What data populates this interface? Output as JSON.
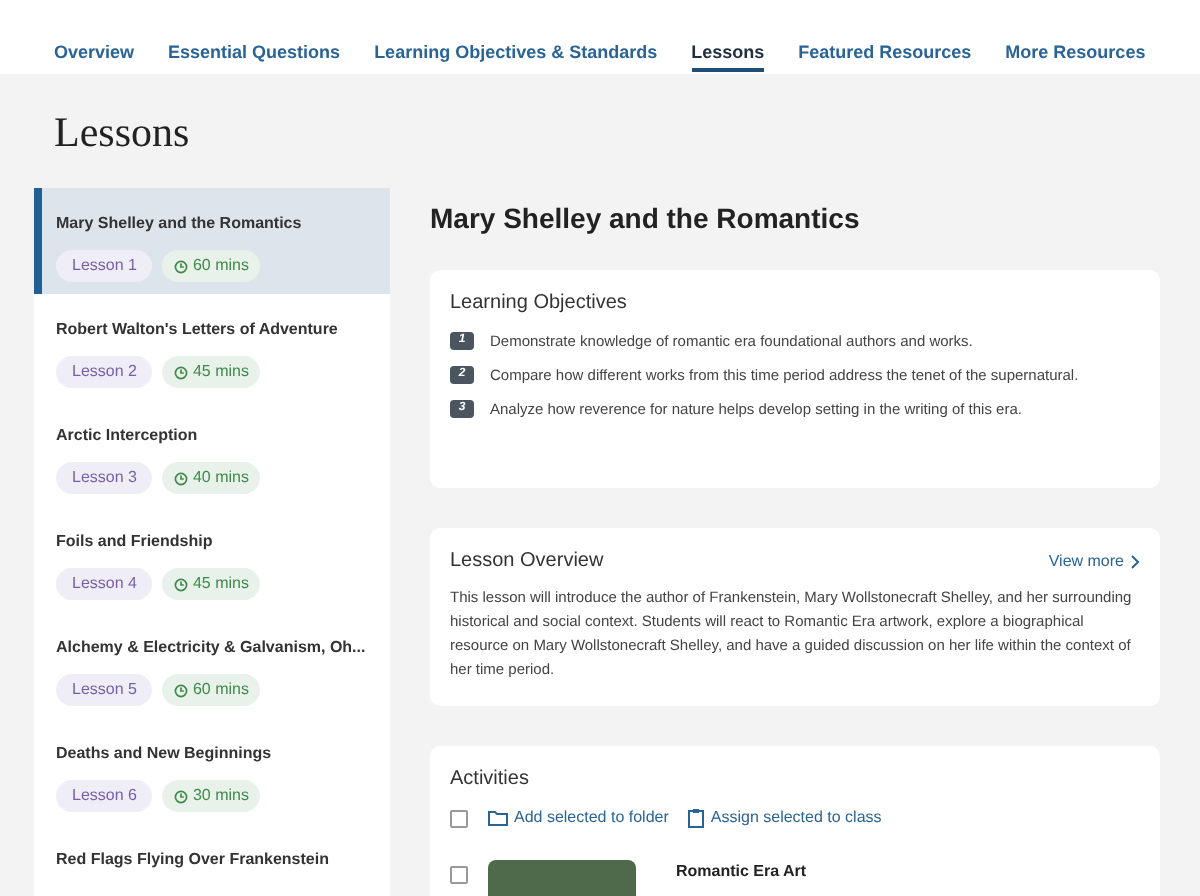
{
  "tabs": [
    {
      "label": "Overview",
      "selected": false
    },
    {
      "label": "Essential Questions",
      "selected": false
    },
    {
      "label": "Learning Objectives & Standards",
      "selected": false
    },
    {
      "label": "Lessons",
      "selected": true
    },
    {
      "label": "Featured Resources",
      "selected": false
    },
    {
      "label": "More Resources",
      "selected": false
    }
  ],
  "page_title": "Lessons",
  "lessons": [
    {
      "title": "Mary Shelley and the Romantics",
      "number": "Lesson 1",
      "duration": "60 mins",
      "selected": true
    },
    {
      "title": "Robert Walton's Letters of Adventure",
      "number": "Lesson 2",
      "duration": "45 mins",
      "selected": false
    },
    {
      "title": "Arctic Interception",
      "number": "Lesson 3",
      "duration": "40 mins",
      "selected": false
    },
    {
      "title": "Foils and Friendship",
      "number": "Lesson 4",
      "duration": "45 mins",
      "selected": false
    },
    {
      "title": "Alchemy & Electricity & Galvanism, Oh...",
      "number": "Lesson 5",
      "duration": "60 mins",
      "selected": false
    },
    {
      "title": "Deaths and New Beginnings",
      "number": "Lesson 6",
      "duration": "30 mins",
      "selected": false
    },
    {
      "title": "Red Flags Flying Over Frankenstein",
      "selected": false
    }
  ],
  "lesson_title": "Mary Shelley and the Romantics",
  "objectives": {
    "heading": "Learning Objectives",
    "items": [
      {
        "number": "1",
        "text": "Demonstrate knowledge of romantic era foundational authors and works."
      },
      {
        "number": "2",
        "text": "Compare how different works from this time period address the tenet of the supernatural."
      },
      {
        "number": "3",
        "text": "Analyze how reverence for nature helps develop setting in the writing of this era."
      }
    ]
  },
  "overview": {
    "heading": "Lesson Overview",
    "link": "View more",
    "text": "This lesson will introduce the author of Frankenstein, Mary Wollstonecraft Shelley, and her surrounding historical and social context. Students will react to Romantic Era artwork, explore a biographical resource on Mary Wollstonecraft Shelley, and have a guided discussion on her life within the context of her time period."
  },
  "activities": {
    "heading": "Activities",
    "select_all_checked": false,
    "actions": [
      "Add selected to folder",
      "Assign selected to class"
    ],
    "items": [
      {
        "title": "Romantic Era Art",
        "checked": false
      }
    ]
  }
}
